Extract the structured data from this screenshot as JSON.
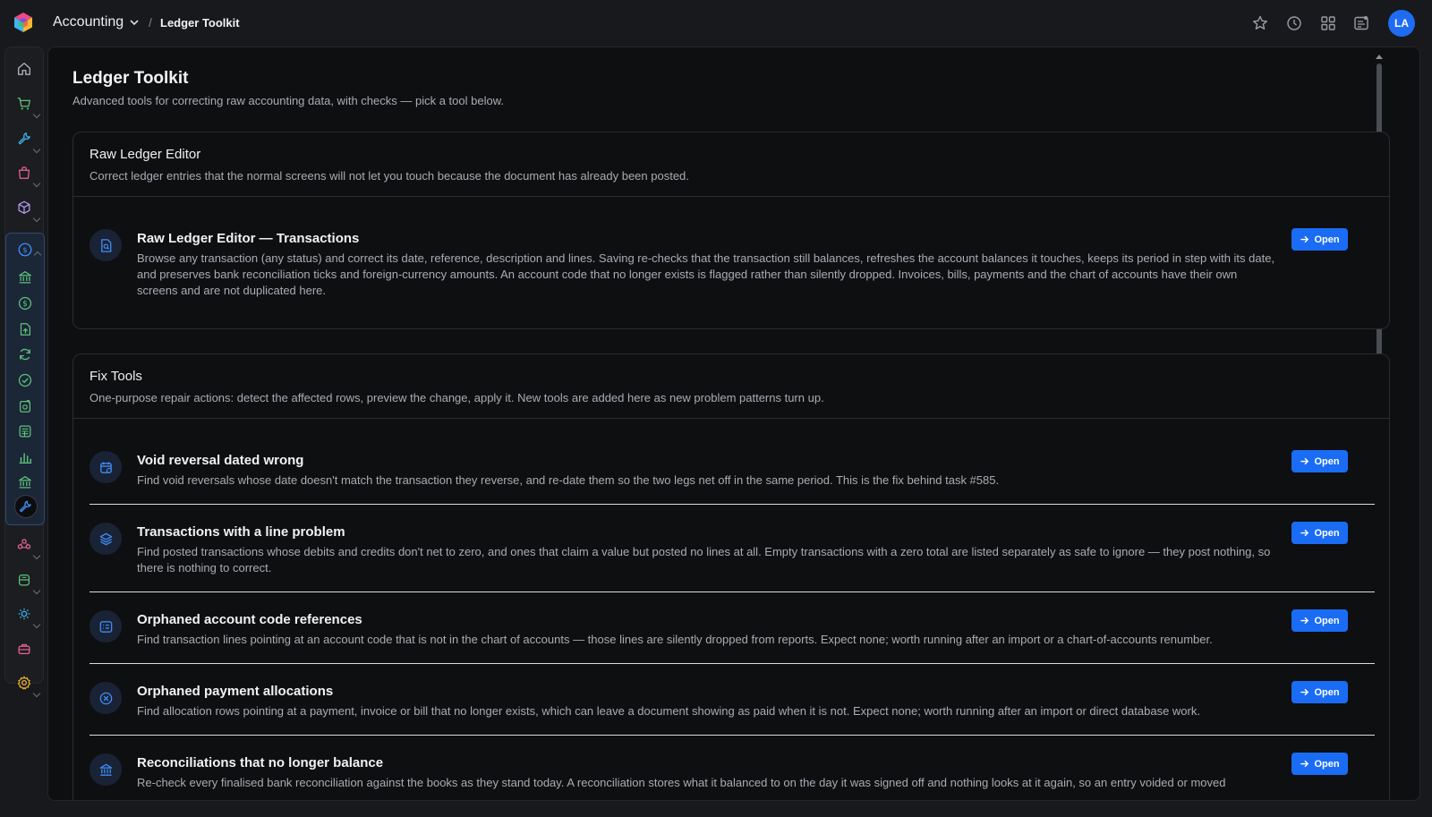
{
  "app": {
    "name": "Accounting",
    "crumb_separator": "/",
    "current_page": "Ledger Toolkit",
    "user_initials": "LA"
  },
  "colors": {
    "accent": "#1a6cf5",
    "sidebar_group_bg": "#1b2637",
    "sidebar_icon_green": "#5ec27a"
  },
  "top_icons": [
    "star-icon",
    "history-clock-icon",
    "apps-grid-icon",
    "notes-icon"
  ],
  "sidebar": {
    "items": [
      "home-icon",
      "cart-icon",
      "wrench-icon",
      "shopping-bag-icon",
      "boxes-icon",
      "accounting-icon",
      "bank-icon",
      "dollar-icon",
      "upload-doc-icon",
      "refresh-icon",
      "check-circle-icon",
      "receipt-icon",
      "calculator-icon",
      "bar-chart-icon",
      "bank-alt-icon",
      "tools-icon",
      "people-icon",
      "database-icon",
      "gears-icon",
      "briefcase-icon",
      "settings-icon"
    ]
  },
  "page": {
    "title": "Ledger Toolkit",
    "subtitle": "Advanced tools for correcting raw accounting data, with checks — pick a tool below."
  },
  "sections": [
    {
      "title": "Raw Ledger Editor",
      "description": "Correct ledger entries that the normal screens will not let you touch because the document has already been posted.",
      "tools": [
        {
          "icon": "search-document-icon",
          "title": "Raw Ledger Editor — Transactions",
          "description": "Browse any transaction (any status) and correct its date, reference, description and lines. Saving re-checks that the transaction still balances, refreshes the account balances it touches, keeps its period in step with its date, and preserves bank reconciliation ticks and foreign-currency amounts. An account code that no longer exists is flagged rather than silently dropped. Invoices, bills, payments and the chart of accounts have their own screens and are not duplicated here.",
          "button": "Open"
        }
      ]
    },
    {
      "title": "Fix Tools",
      "description": "One-purpose repair actions: detect the affected rows, preview the change, apply it. New tools are added here as new problem patterns turn up.",
      "tools": [
        {
          "icon": "calendar-icon",
          "title": "Void reversal dated wrong",
          "description": "Find void reversals whose date doesn't match the transaction they reverse, and re-date them so the two legs net off in the same period. This is the fix behind task #585.",
          "button": "Open"
        },
        {
          "icon": "layers-icon",
          "title": "Transactions with a line problem",
          "description": "Find posted transactions whose debits and credits don't net to zero, and ones that claim a value but posted no lines at all. Empty transactions with a zero total are listed separately as safe to ignore — they post nothing, so there is nothing to correct.",
          "button": "Open"
        },
        {
          "icon": "list-card-icon",
          "title": "Orphaned account code references",
          "description": "Find transaction lines pointing at an account code that is not in the chart of accounts — those lines are silently dropped from reports. Expect none; worth running after an import or a chart-of-accounts renumber.",
          "button": "Open"
        },
        {
          "icon": "x-circle-icon",
          "title": "Orphaned payment allocations",
          "description": "Find allocation rows pointing at a payment, invoice or bill that no longer exists, which can leave a document showing as paid when it is not. Expect none; worth running after an import or direct database work.",
          "button": "Open"
        },
        {
          "icon": "bank-icon",
          "title": "Reconciliations that no longer balance",
          "description": "Re-check every finalised bank reconciliation against the books as they stand today. A reconciliation stores what it balanced to on the day it was signed off and nothing looks at it again, so an entry voided or moved",
          "button": "Open"
        }
      ]
    }
  ]
}
